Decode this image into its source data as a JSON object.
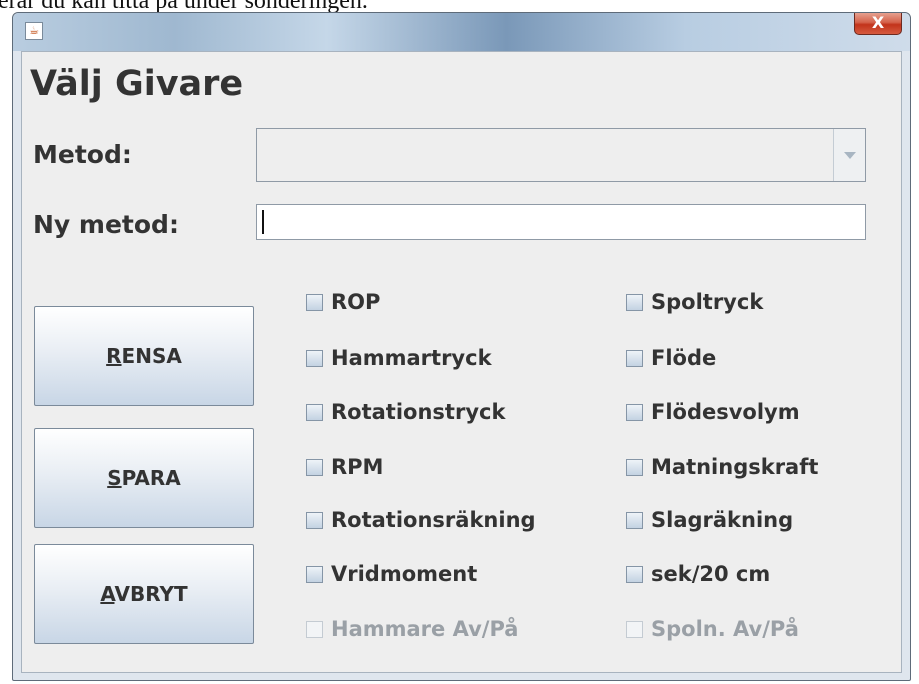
{
  "background": {
    "partial_text": "erar du kan titta på under sonderingen."
  },
  "window": {
    "close_label": "X"
  },
  "form": {
    "heading": "Välj Givare",
    "metod_label": "Metod:",
    "metod_value": "",
    "ny_metod_label": "Ny metod:",
    "ny_metod_value": ""
  },
  "buttons": {
    "rensa": {
      "mnemonic": "R",
      "rest": "ENSA"
    },
    "spara": {
      "mnemonic": "S",
      "rest": "PARA"
    },
    "avbryt": {
      "mnemonic": "A",
      "rest": "VBRYT"
    }
  },
  "checkboxes_left": [
    {
      "label": "ROP",
      "checked": false,
      "enabled": true
    },
    {
      "label": "Hammartryck",
      "checked": false,
      "enabled": true
    },
    {
      "label": "Rotationstryck",
      "checked": false,
      "enabled": true
    },
    {
      "label": "RPM",
      "checked": false,
      "enabled": true
    },
    {
      "label": "Rotationsräkning",
      "checked": false,
      "enabled": true
    },
    {
      "label": "Vridmoment",
      "checked": false,
      "enabled": true
    },
    {
      "label": "Hammare Av/På",
      "checked": false,
      "enabled": false
    }
  ],
  "checkboxes_right": [
    {
      "label": "Spoltryck",
      "checked": false,
      "enabled": true
    },
    {
      "label": "Flöde",
      "checked": false,
      "enabled": true
    },
    {
      "label": "Flödesvolym",
      "checked": false,
      "enabled": true
    },
    {
      "label": "Matningskraft",
      "checked": false,
      "enabled": true
    },
    {
      "label": "Slagräkning",
      "checked": false,
      "enabled": true
    },
    {
      "label": "sek/20 cm",
      "checked": false,
      "enabled": true
    },
    {
      "label": "Spoln. Av/På",
      "checked": false,
      "enabled": false
    }
  ]
}
